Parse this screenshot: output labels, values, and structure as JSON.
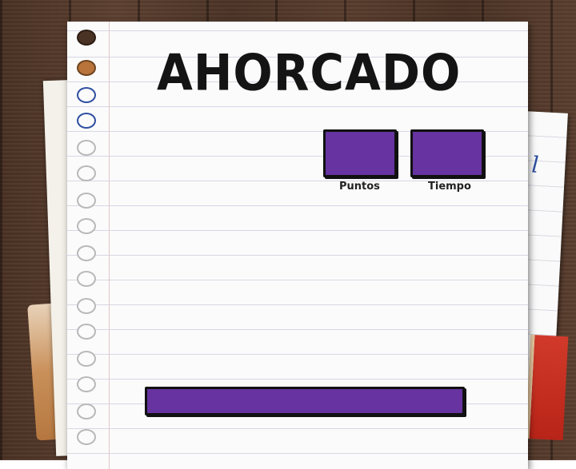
{
  "game": {
    "title": "AHORCADO",
    "stats": {
      "points_label": "Puntos",
      "time_label": "Tiempo"
    }
  },
  "colors": {
    "panel_fill": "#6633a0",
    "panel_border": "#111111",
    "paper": "#fbfbfb",
    "desk_wood": "#4f3628"
  }
}
